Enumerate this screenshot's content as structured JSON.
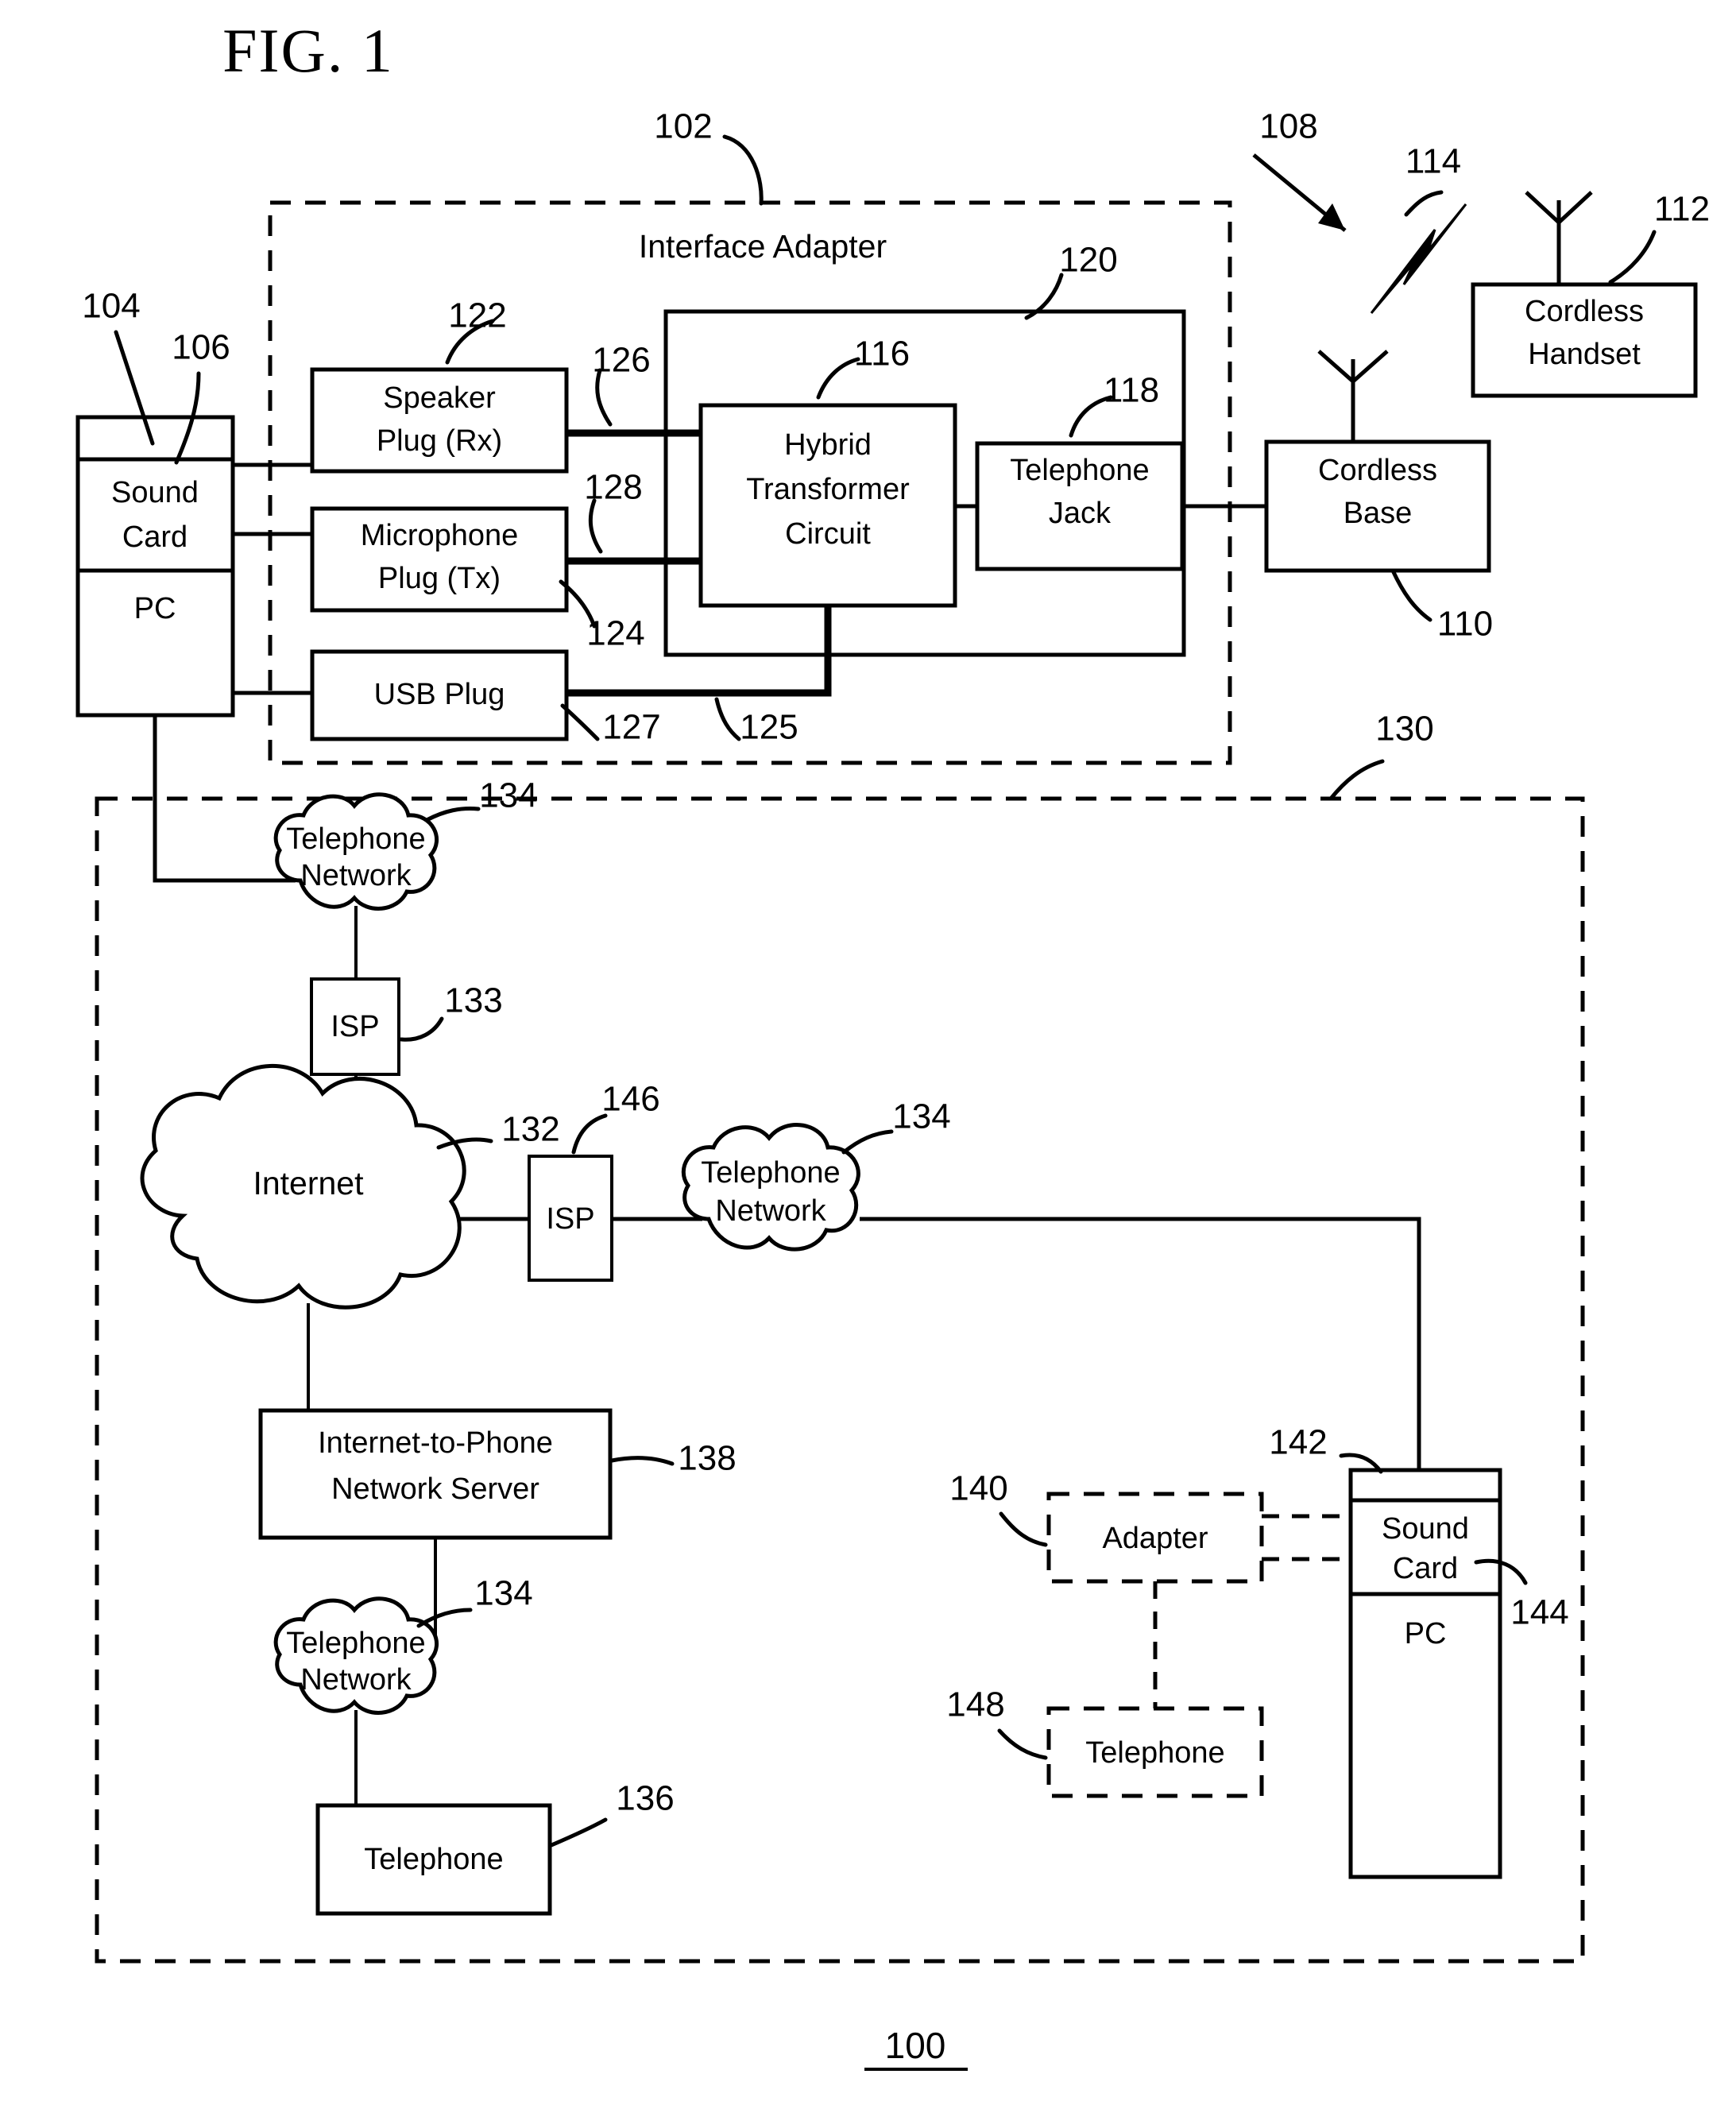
{
  "figure": {
    "title": "FIG. 1",
    "footer_ref": "100"
  },
  "interface_adapter_section": {
    "title": "Interface Adapter",
    "ref": "102",
    "inner_assembly_ref": "120",
    "boxes": {
      "speaker_plug": {
        "label": "Speaker\nPlug (Rx)",
        "line1": "Speaker",
        "line2": "Plug (Rx)",
        "ref": "122"
      },
      "microphone_plug": {
        "line1": "Microphone",
        "line2": "Plug (Tx)",
        "ref": "124"
      },
      "usb_plug": {
        "line1": "USB Plug",
        "ref": "127"
      },
      "hybrid_transformer": {
        "line1": "Hybrid",
        "line2": "Transformer",
        "line3": "Circuit",
        "ref": "116"
      },
      "telephone_jack": {
        "line1": "Telephone",
        "line2": "Jack",
        "ref": "118"
      }
    },
    "wire_refs": {
      "speaker_to_hybrid": "126",
      "microphone_to_hybrid": "128",
      "usb_to_hybrid": "125"
    }
  },
  "pc_top": {
    "sound_card_line1": "Sound",
    "sound_card_line2": "Card",
    "pc_label": "PC",
    "sound_card_ref": "104",
    "pc_ref": "106"
  },
  "cordless_section": {
    "ref": "108",
    "rf_link_ref": "114",
    "base": {
      "line1": "Cordless",
      "line2": "Base",
      "ref": "110"
    },
    "handset": {
      "line1": "Cordless",
      "line2": "Handset",
      "ref": "112"
    }
  },
  "network_section": {
    "ref": "130",
    "telephone_network_top": {
      "line1": "Telephone",
      "line2": "Network",
      "ref": "134"
    },
    "isp_top": {
      "label": "ISP",
      "ref": "133"
    },
    "internet": {
      "label": "Internet",
      "ref": "132"
    },
    "isp_right": {
      "label": "ISP",
      "ref": "146"
    },
    "telephone_network_right": {
      "line1": "Telephone",
      "line2": "Network",
      "ref": "134"
    },
    "server": {
      "line1": "Internet-to-Phone",
      "line2": "Network Server",
      "ref": "138"
    },
    "telephone_network_bottom": {
      "line1": "Telephone",
      "line2": "Network",
      "ref": "134"
    },
    "telephone_bottom": {
      "label": "Telephone",
      "ref": "136"
    },
    "adapter_optional": {
      "label": "Adapter",
      "ref": "140"
    },
    "telephone_optional": {
      "label": "Telephone",
      "ref": "148"
    },
    "pc_bottom": {
      "sound_card_line1": "Sound",
      "sound_card_line2": "Card",
      "pc_label": "PC",
      "sound_card_ref": "142",
      "pc_ref": "144"
    }
  }
}
